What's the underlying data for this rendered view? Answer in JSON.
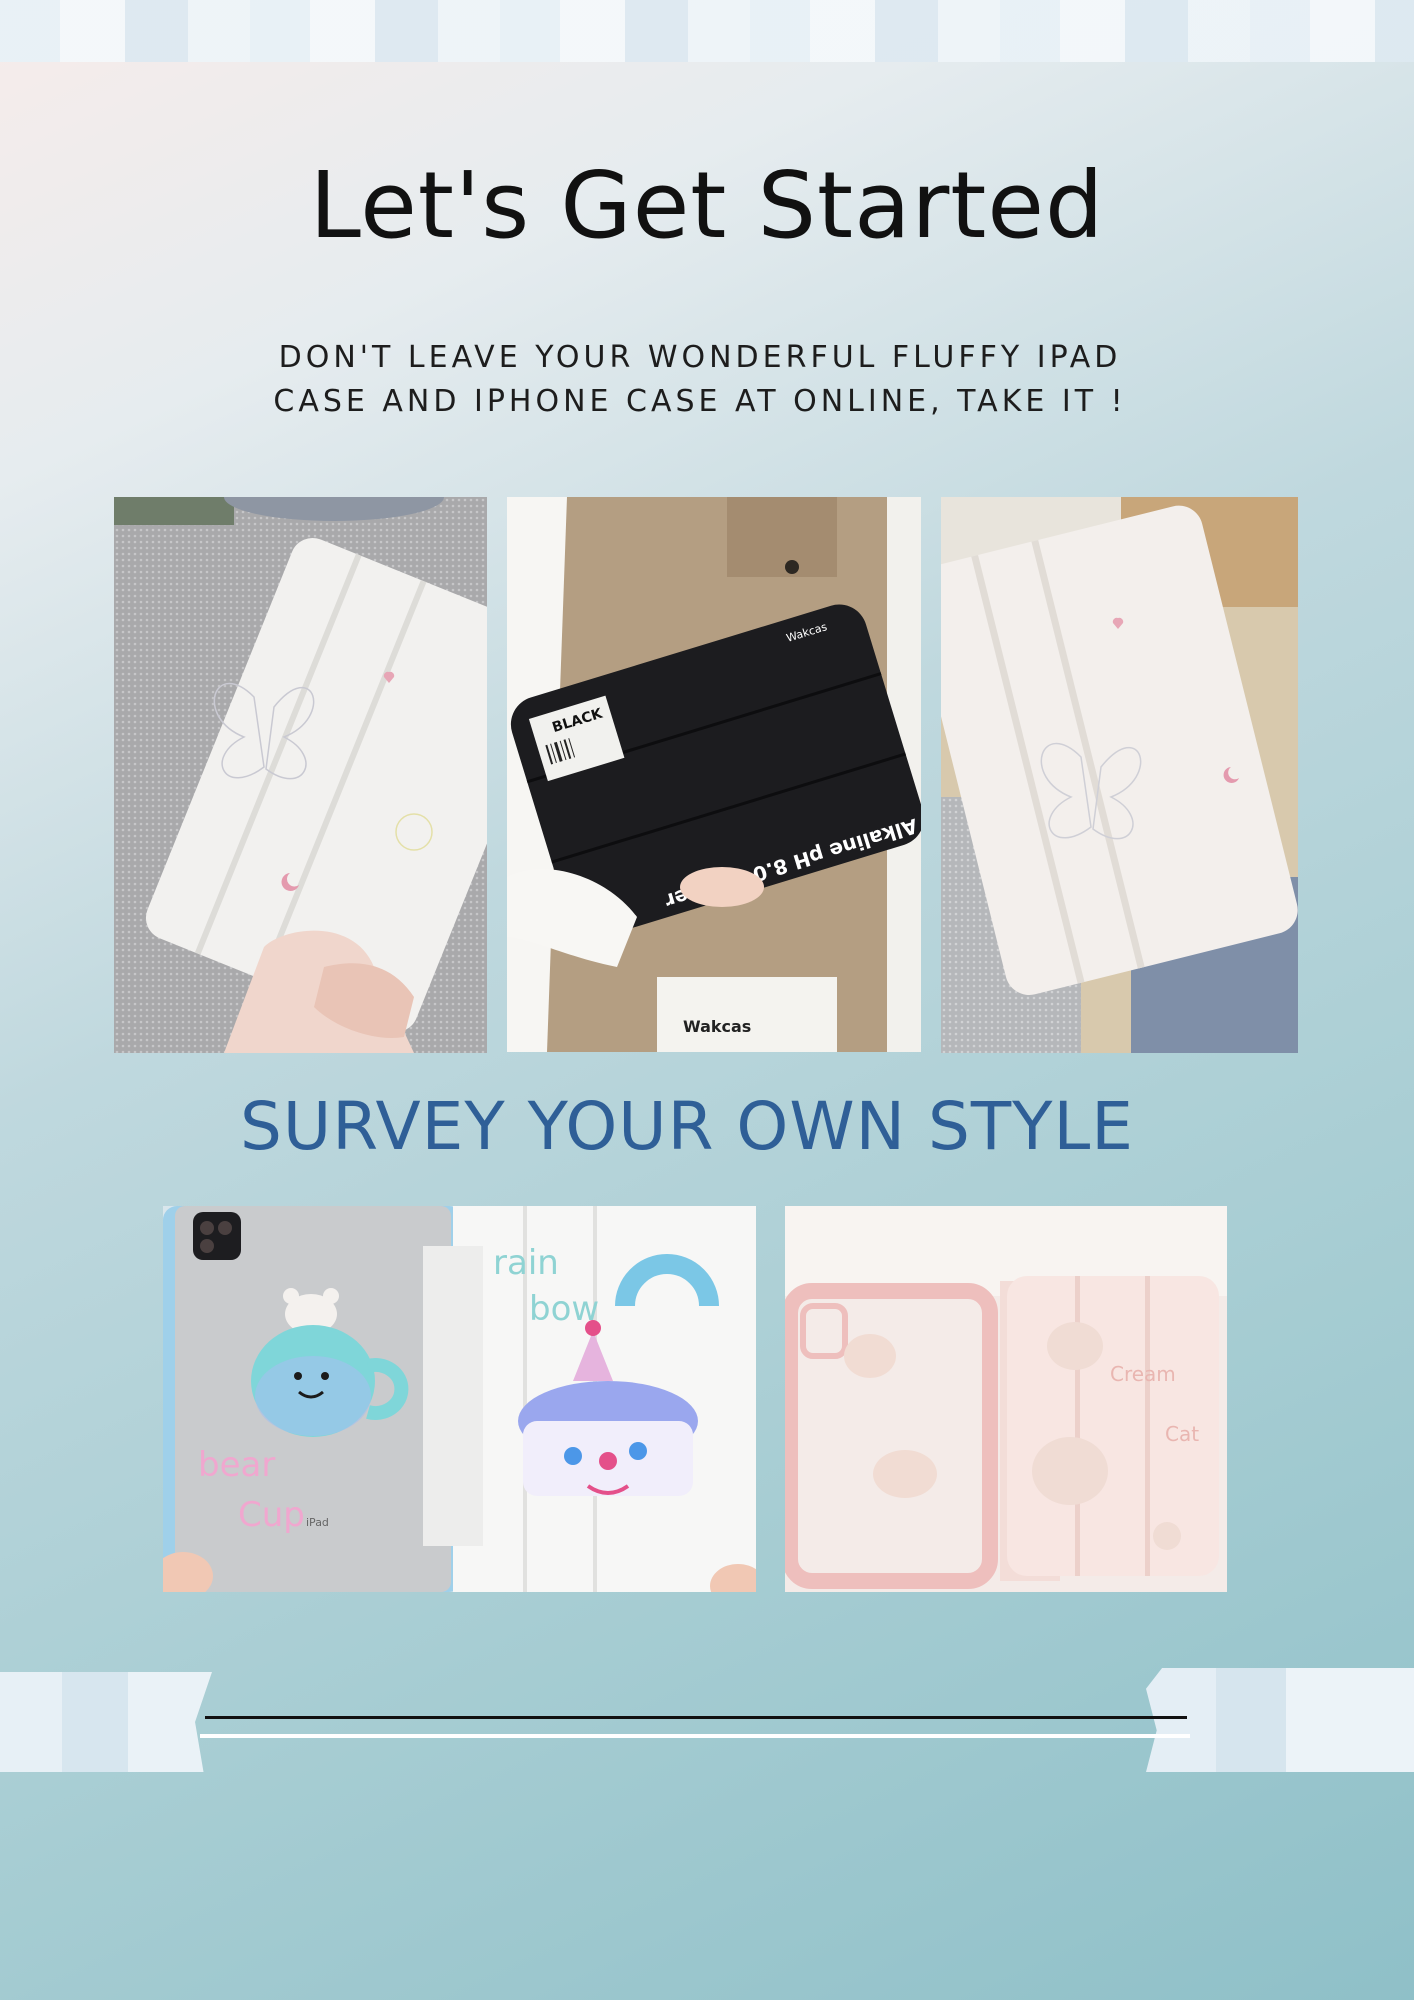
{
  "heading": "Let's Get Started",
  "subheading_lines": [
    "DON'T LEAVE YOUR WONDERFUL FLUFFY IPAD",
    "CASE AND IPHONE CASE AT ONLINE, TAKE IT !"
  ],
  "section_heading": "SURVEY YOUR OWN STYLE",
  "photo_texts": {
    "brand": "Wakcas",
    "label": "BLACK",
    "slogan": "Alkaline pH 8.0+ Water",
    "bear_cup_1": "bear",
    "bear_cup_2": "Cup",
    "ipad": "iPad",
    "rain": "rain",
    "bow": "bow",
    "cream": "Cream",
    "cat": "Cat"
  },
  "colors": {
    "title": "#111111",
    "section_title": "#2f5f97",
    "background_top": "#f7ecea",
    "background_bottom": "#8fc0c8"
  },
  "icons": [
    "butterfly-icon",
    "heart-icon",
    "moon-icon",
    "rainbow-icon",
    "bear-icon",
    "cake-icon"
  ]
}
